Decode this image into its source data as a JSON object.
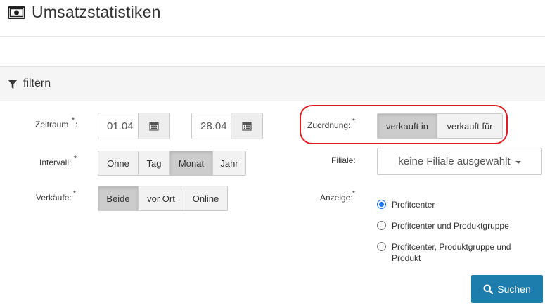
{
  "header": {
    "title": "Umsatzstatistiken",
    "icon": "money-icon"
  },
  "filter": {
    "label": "filtern",
    "icon": "funnel-icon"
  },
  "fields": {
    "zeitraum": {
      "label": "Zeitraum",
      "required_mark": "*",
      "from_value": "01.04",
      "to_value": "28.04",
      "calendar_icon": "calendar-icon"
    },
    "intervall": {
      "label": "Intervall:",
      "required_mark": "*",
      "options": [
        "Ohne",
        "Tag",
        "Monat",
        "Jahr"
      ],
      "selected": "Monat"
    },
    "verkaeufe": {
      "label": "Verkäufe:",
      "required_mark": "*",
      "options": [
        "Beide",
        "vor Ort",
        "Online"
      ],
      "selected": "Beide"
    },
    "zuordnung": {
      "label": "Zuordnung:",
      "required_mark": "*",
      "options": [
        "verkauft in",
        "verkauft für"
      ],
      "selected": "verkauft in"
    },
    "filiale": {
      "label": "Filiale:",
      "value": "keine Filiale ausgewählt"
    },
    "anzeige": {
      "label": "Anzeige:",
      "required_mark": "*",
      "options": [
        "Profitcenter",
        "Profitcenter und Produktgruppe",
        "Profitcenter, Produktgruppe und Produkt"
      ],
      "selected": "Profitcenter"
    }
  },
  "actions": {
    "search_label": "Suchen"
  },
  "colors": {
    "primary_button": "#1d7dad",
    "highlight_ring": "#e01b22",
    "radio_checked": "#1a73e8"
  }
}
